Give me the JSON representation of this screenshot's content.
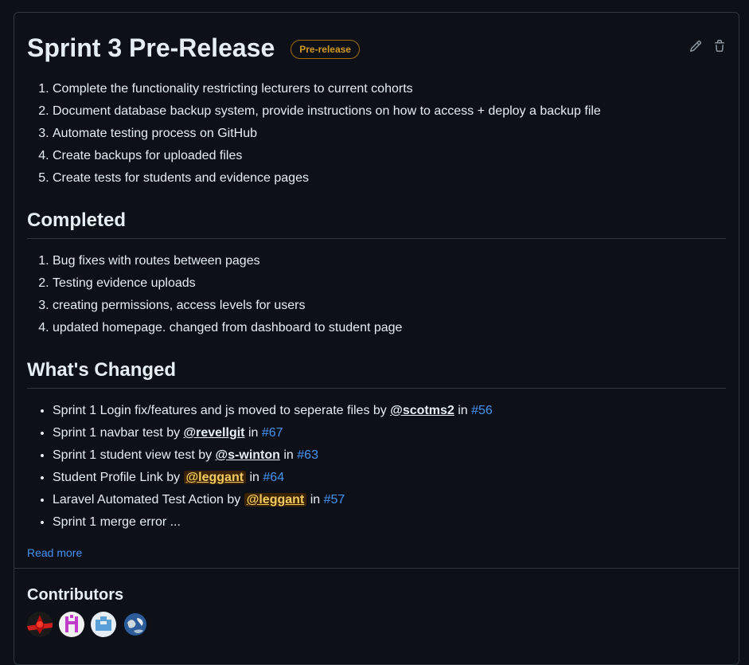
{
  "release": {
    "title": "Sprint 3 Pre-Release",
    "badge": "Pre-release",
    "edit_icon": "pencil-icon",
    "delete_icon": "trash-icon"
  },
  "todo": [
    "Complete the functionality restricting lecturers to current cohorts",
    "Document database backup system, provide instructions on how to access + deploy a backup file",
    "Automate testing process on GitHub",
    "Create backups for uploaded files",
    "Create tests for students and evidence pages"
  ],
  "completed": {
    "heading": "Completed",
    "items": [
      "Bug fixes with routes between pages",
      "Testing evidence uploads",
      "creating permissions, access levels for users",
      "updated homepage. changed from dashboard to student page"
    ]
  },
  "changes": {
    "heading": "What's Changed",
    "items": [
      {
        "text": "Sprint 1 Login fix/features and js moved to seperate files by ",
        "author": "@scotms2",
        "in": " in ",
        "pr": "#56"
      },
      {
        "text": "Sprint 1 navbar test by ",
        "author": "@revellgit",
        "in": " in ",
        "pr": "#67"
      },
      {
        "text": "Sprint 1 student view test by ",
        "author": "@s-winton",
        "in": " in ",
        "pr": "#63"
      },
      {
        "text": "Student Profile Link by ",
        "author": "@leggant",
        "in": " in ",
        "pr": "#64"
      },
      {
        "text": "Laravel Automated Test Action by ",
        "author": "@leggant",
        "in": " in ",
        "pr": "#57"
      },
      {
        "text": "Sprint 1 merge error ..."
      }
    ],
    "read_more": "Read more"
  },
  "contributors": {
    "heading": "Contributors"
  },
  "colors": {
    "background": "#0d1117",
    "text": "#e6edf3",
    "link": "#4493f8",
    "badge": "#d29922",
    "border": "#30363d",
    "highlight_bg": "#3b2300",
    "highlight_text": "#f2cc60"
  }
}
